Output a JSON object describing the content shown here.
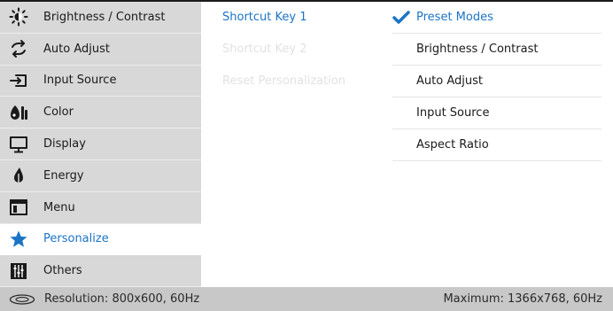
{
  "sidebar": {
    "items": [
      {
        "label": "Brightness / Contrast",
        "icon": "brightness-icon"
      },
      {
        "label": "Auto Adjust",
        "icon": "auto-adjust-icon"
      },
      {
        "label": "Input Source",
        "icon": "input-source-icon"
      },
      {
        "label": "Color",
        "icon": "color-icon"
      },
      {
        "label": "Display",
        "icon": "display-icon"
      },
      {
        "label": "Energy",
        "icon": "energy-icon"
      },
      {
        "label": "Menu",
        "icon": "menu-icon"
      },
      {
        "label": "Personalize",
        "icon": "star-icon"
      },
      {
        "label": "Others",
        "icon": "others-icon"
      }
    ],
    "active_index": 7
  },
  "personalize": {
    "shortcut_key_1": "Shortcut Key 1",
    "shortcut_key_2": "Shortcut Key 2",
    "reset_personalization": "Reset Personalization"
  },
  "options": [
    {
      "label": "Preset Modes",
      "selected": true
    },
    {
      "label": "Brightness / Contrast",
      "selected": false
    },
    {
      "label": "Auto Adjust",
      "selected": false
    },
    {
      "label": "Input Source",
      "selected": false
    },
    {
      "label": "Aspect Ratio",
      "selected": false
    }
  ],
  "status": {
    "resolution": "Resolution: 800x600, 60Hz",
    "maximum": "Maximum: 1366x768, 60Hz"
  },
  "colors": {
    "accent": "#1b74c5",
    "sidebar_bg": "#d8d8d8",
    "status_bg": "#c8c8c8",
    "disabled_text": "#e2e2e2"
  }
}
